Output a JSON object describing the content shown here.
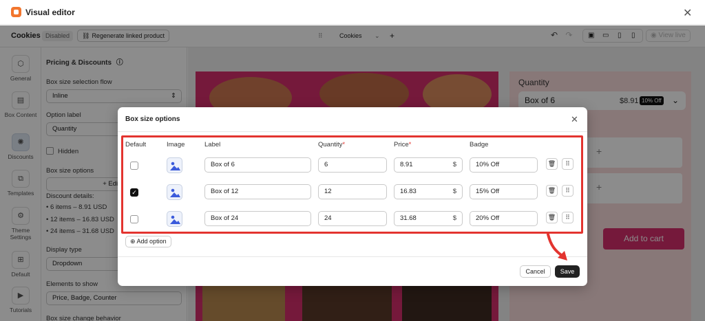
{
  "window": {
    "title": "Visual editor"
  },
  "toolbar": {
    "product_name": "Cookies",
    "status": "Disabled",
    "regenerate_label": "Regenerate linked product",
    "template_name": "Cookies",
    "view_live_label": "View live"
  },
  "sidebar": {
    "items": [
      {
        "label": "General",
        "icon": "cube-icon"
      },
      {
        "label": "Box Content",
        "icon": "box-content-icon"
      },
      {
        "label": "Discounts",
        "icon": "discount-icon"
      },
      {
        "label": "Templates",
        "icon": "template-icon"
      },
      {
        "label": "Theme Settings",
        "icon": "gear-icon"
      },
      {
        "label": "Default",
        "icon": "default-icon"
      },
      {
        "label": "Tutorials",
        "icon": "video-icon"
      }
    ]
  },
  "panel": {
    "title": "Pricing & Discounts",
    "flow_label": "Box size selection flow",
    "flow_value": "Inline",
    "option_label": "Option label",
    "option_value": "Quantity",
    "hidden_label": "Hidden",
    "box_size_options_label": "Box size options",
    "edit_label": "+ Edit o",
    "discount_details_label": "Discount details:",
    "discount_lines": [
      "6 items – 8.91 USD",
      "12 items – 16.83 USD",
      "24 items – 31.68 USD"
    ],
    "display_type_label": "Display type",
    "display_type_value": "Dropdown",
    "elements_label": "Elements to show",
    "elements_value": "Price, Badge, Counter",
    "change_behavior_label": "Box size change behavior"
  },
  "preview": {
    "quantity_label": "Quantity",
    "selected_option": "Box of 6",
    "selected_price": "$8.91",
    "selected_badge": "10% Off",
    "add_to_cart": "Add to cart"
  },
  "modal": {
    "title": "Box size options",
    "headers": {
      "default": "Default",
      "image": "Image",
      "label": "Label",
      "quantity": "Quantity",
      "price": "Price",
      "badge": "Badge"
    },
    "currency": "$",
    "rows": [
      {
        "default": false,
        "label": "Box of 6",
        "quantity": "6",
        "price": "8.91",
        "badge": "10% Off"
      },
      {
        "default": true,
        "label": "Box of 12",
        "quantity": "12",
        "price": "16.83",
        "badge": "15% Off"
      },
      {
        "default": false,
        "label": "Box of 24",
        "quantity": "24",
        "price": "31.68",
        "badge": "20% Off"
      }
    ],
    "add_option_label": "Add option",
    "cancel_label": "Cancel",
    "save_label": "Save"
  },
  "colors": {
    "accent": "#d62e6c",
    "highlight": "#e3342f",
    "primary_button": "#222222"
  }
}
